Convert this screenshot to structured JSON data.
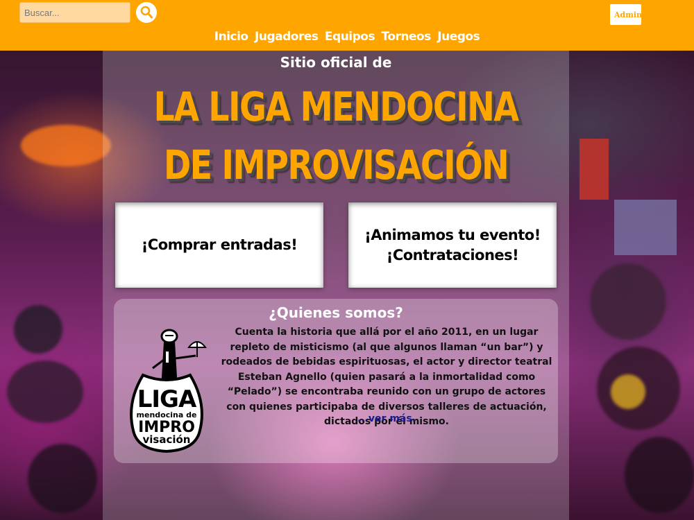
{
  "header": {
    "search": {
      "placeholder": "Buscar...",
      "value": "",
      "icon": "search-icon"
    },
    "admin_label": "Admin",
    "nav": [
      "Inicio",
      "Jugadores",
      "Equipos",
      "Torneos",
      "Juegos"
    ]
  },
  "hero": {
    "subtitle": "Sitio oficial de",
    "title_line1": "LA LIGA MENDOCINA",
    "title_line2": "DE IMPROVISACIÓN"
  },
  "cards": {
    "tickets": "¡Comprar entradas!",
    "events_line1": "¡Animamos tu evento!",
    "events_line2": "¡Contrataciones!"
  },
  "about": {
    "title": "¿Quienes somos?",
    "text": "Cuenta la historia que allá por el año 2011, en un lugar repleto de misticismo (al que algunos llaman “un bar”) y rodeados de bebidas espirituosas, el actor y director teatral Esteban Agnello (quien pasará a la inmortalidad como “Pelado”) se encontraba reunido con un grupo de actores con quienes participaba de diversos talleres de actuación, dictados por él mismo.",
    "more_label": "...ver más.",
    "logo": {
      "line1": "LIGA",
      "line2": "mendocina de",
      "line3": "IMPRO",
      "line4": "visación"
    }
  },
  "colors": {
    "accent": "#ffa500",
    "link": "#1a1a8c",
    "title_shadow": "#4a4a4a"
  }
}
